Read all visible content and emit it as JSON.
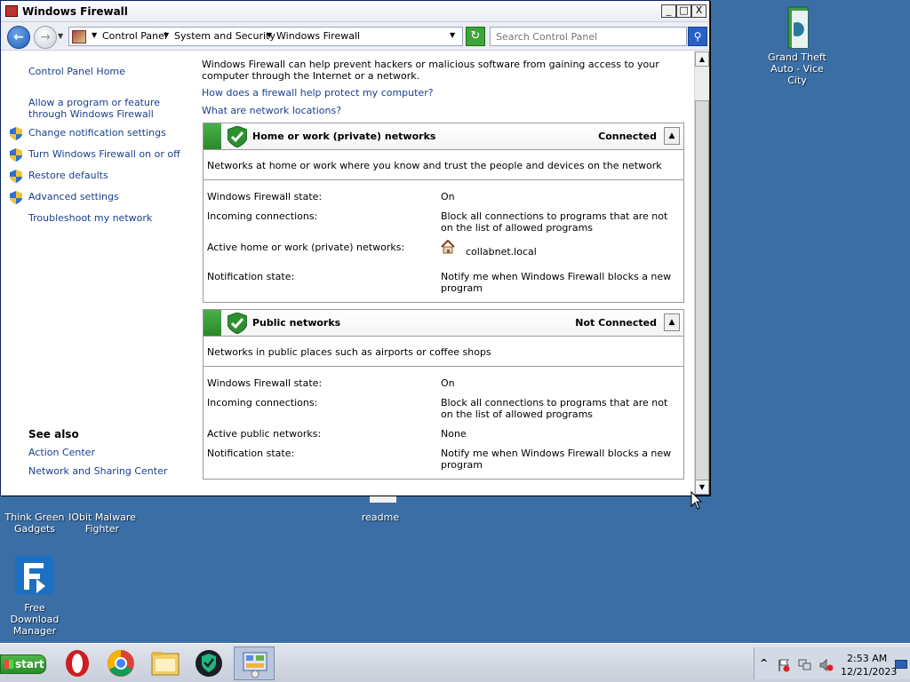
{
  "window": {
    "title": "Windows Firewall",
    "min": "_",
    "max": "□",
    "close": "X"
  },
  "address": {
    "crumbs": [
      "Control Panel",
      "System and Security",
      "Windows Firewall"
    ],
    "search_placeholder": "Search Control Panel"
  },
  "leftnav": {
    "home": "Control Panel Home",
    "links": [
      "Allow a program or feature through Windows Firewall",
      "Change notification settings",
      "Turn Windows Firewall on or off",
      "Restore defaults",
      "Advanced settings",
      "Troubleshoot my network"
    ],
    "see_also_title": "See also",
    "see_also": [
      "Action Center",
      "Network and Sharing Center"
    ]
  },
  "main": {
    "intro": "Windows Firewall can help prevent hackers or malicious software from gaining access to your computer through the Internet or a network.",
    "link1": "How does a firewall help protect my computer?",
    "link2": "What are network locations?",
    "home_panel": {
      "title": "Home or work (private) networks",
      "status": "Connected",
      "desc": "Networks at home or work where you know and trust the people and devices on the network",
      "rows": [
        {
          "label": "Windows Firewall state:",
          "value": "On"
        },
        {
          "label": "Incoming connections:",
          "value": "Block all connections to programs that are not on the list of allowed programs"
        },
        {
          "label": "Active home or work (private) networks:",
          "value": "collabnet.local"
        },
        {
          "label": "Notification state:",
          "value": "Notify me when Windows Firewall blocks a new program"
        }
      ]
    },
    "public_panel": {
      "title": "Public networks",
      "status": "Not Connected",
      "desc": "Networks in public places such as airports or coffee shops",
      "rows": [
        {
          "label": "Windows Firewall state:",
          "value": "On"
        },
        {
          "label": "Incoming connections:",
          "value": "Block all connections to programs that are not on the list of allowed programs"
        },
        {
          "label": "Active public networks:",
          "value": "None"
        },
        {
          "label": "Notification state:",
          "value": "Notify me when Windows Firewall blocks a new program"
        }
      ]
    }
  },
  "desktop": {
    "icons": [
      {
        "label": "Grand Theft Auto - Vice City",
        "icon": "folder-icon"
      },
      {
        "label": "Think Green Gadgets",
        "icon": "gadget-icon"
      },
      {
        "label": "IObit Malware Fighter",
        "icon": "shield-icon"
      },
      {
        "label": "readme",
        "icon": "text-file-icon"
      },
      {
        "label": "Free Download Manager",
        "icon": "download-manager-icon"
      }
    ]
  },
  "taskbar": {
    "start": "start",
    "time": "2:53 AM",
    "date": "12/21/2023",
    "tray_arrow": "^"
  }
}
